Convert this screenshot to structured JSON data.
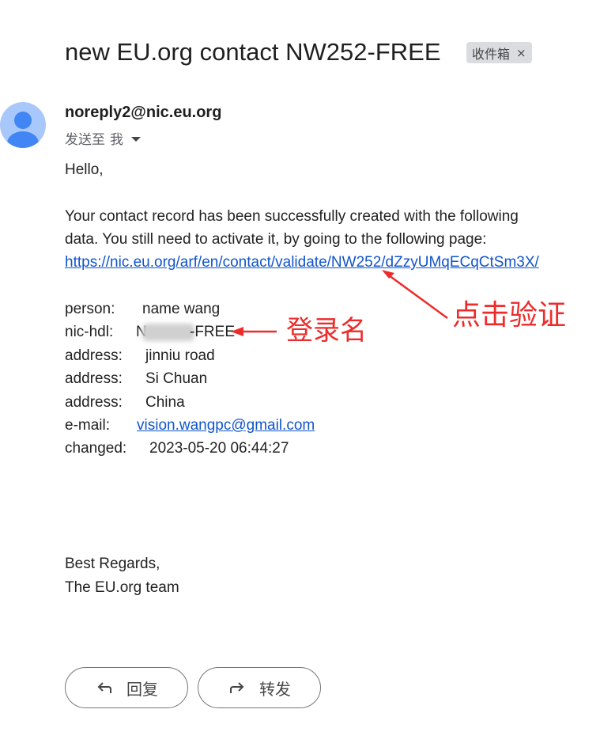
{
  "email": {
    "subject": "new EU.org contact NW252-FREE",
    "label": "收件箱",
    "label_remove": "×",
    "sender": "noreply2@nic.eu.org",
    "to_prefix": "发送至",
    "to_me": "我"
  },
  "body": {
    "greeting": "Hello,",
    "para_line1": "Your contact record has been successfully created with the following",
    "para_line2": "data. You still need to activate it, by going to the following page:",
    "validate_link": "https://nic.eu.org/arf/en/contact/validate/NW252/dZzyUMqECqCtSm3X/",
    "fields": {
      "person_label": "person:",
      "person_value": "name wang",
      "nichdl_label": "nic-hdl:",
      "nichdl_value_start": "N",
      "nichdl_value_end": "-FREE",
      "address_label": "address:",
      "address1": "jinniu road",
      "address2": "Si Chuan",
      "address3": "China",
      "email_label": "e-mail:",
      "email_value": "vision.wangpc@gmail.com",
      "changed_label": "changed:",
      "changed_value": "2023-05-20 06:44:27"
    },
    "regards": "Best Regards,",
    "team": "The EU.org team"
  },
  "annotations": {
    "click_verify": "点击验证",
    "login_name": "登录名",
    "color": "#ee2b2b"
  },
  "actions": {
    "reply": "回复",
    "forward": "转发"
  }
}
